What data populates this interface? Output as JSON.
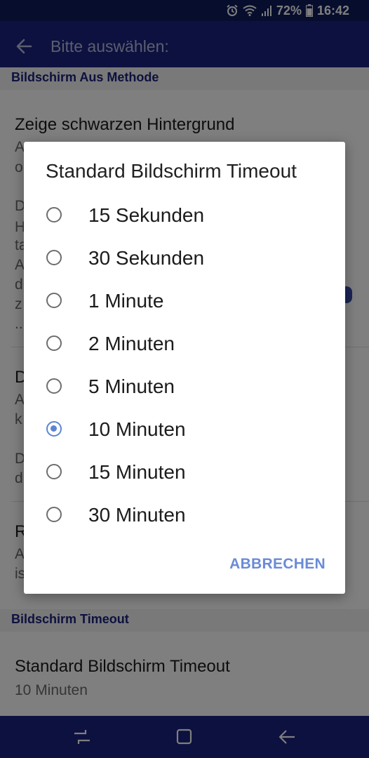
{
  "status_bar": {
    "battery_percent": "72%",
    "time": "16:42",
    "icons": [
      "alarm-icon",
      "wifi-icon",
      "signal-icon",
      "battery-icon"
    ]
  },
  "app_bar": {
    "title": "Bitte auswählen:",
    "back_icon": "arrow-back-icon"
  },
  "settings": {
    "section1_header": "Bildschirm Aus Methode",
    "pref1_title": "Zeige schwarzen Hintergrund",
    "pref1_summary_fragments": [
      "A",
      "o"
    ],
    "pref1_detail_fragments": [
      "D",
      "H",
      "ta",
      "A",
      "d",
      "z",
      "..."
    ],
    "pref2_title_fragment": "D",
    "pref2_summary_fragments": [
      "A",
      "k"
    ],
    "pref2_detail_fragments": [
      "D",
      "d"
    ],
    "pref3_title_fragment": "R",
    "pref3_summary_fragments": [
      "A",
      "is"
    ],
    "section2_header": "Bildschirm Timeout",
    "timeout_title": "Standard Bildschirm Timeout",
    "timeout_value": "10 Minuten"
  },
  "dialog": {
    "title": "Standard Bildschirm Timeout",
    "options": [
      {
        "label": "15 Sekunden",
        "checked": false
      },
      {
        "label": "30 Sekunden",
        "checked": false
      },
      {
        "label": "1 Minute",
        "checked": false
      },
      {
        "label": "2 Minuten",
        "checked": false
      },
      {
        "label": "5 Minuten",
        "checked": false
      },
      {
        "label": "10 Minuten",
        "checked": true
      },
      {
        "label": "15 Minuten",
        "checked": false
      },
      {
        "label": "30 Minuten",
        "checked": false
      }
    ],
    "cancel_label": "ABBRECHEN"
  },
  "nav_bar": {
    "icons": [
      "recents-icon",
      "home-icon",
      "back-icon"
    ]
  },
  "colors": {
    "primary": "#1a237e",
    "accent": "#5c85d6",
    "section_header_bg": "#f2f2f2"
  }
}
